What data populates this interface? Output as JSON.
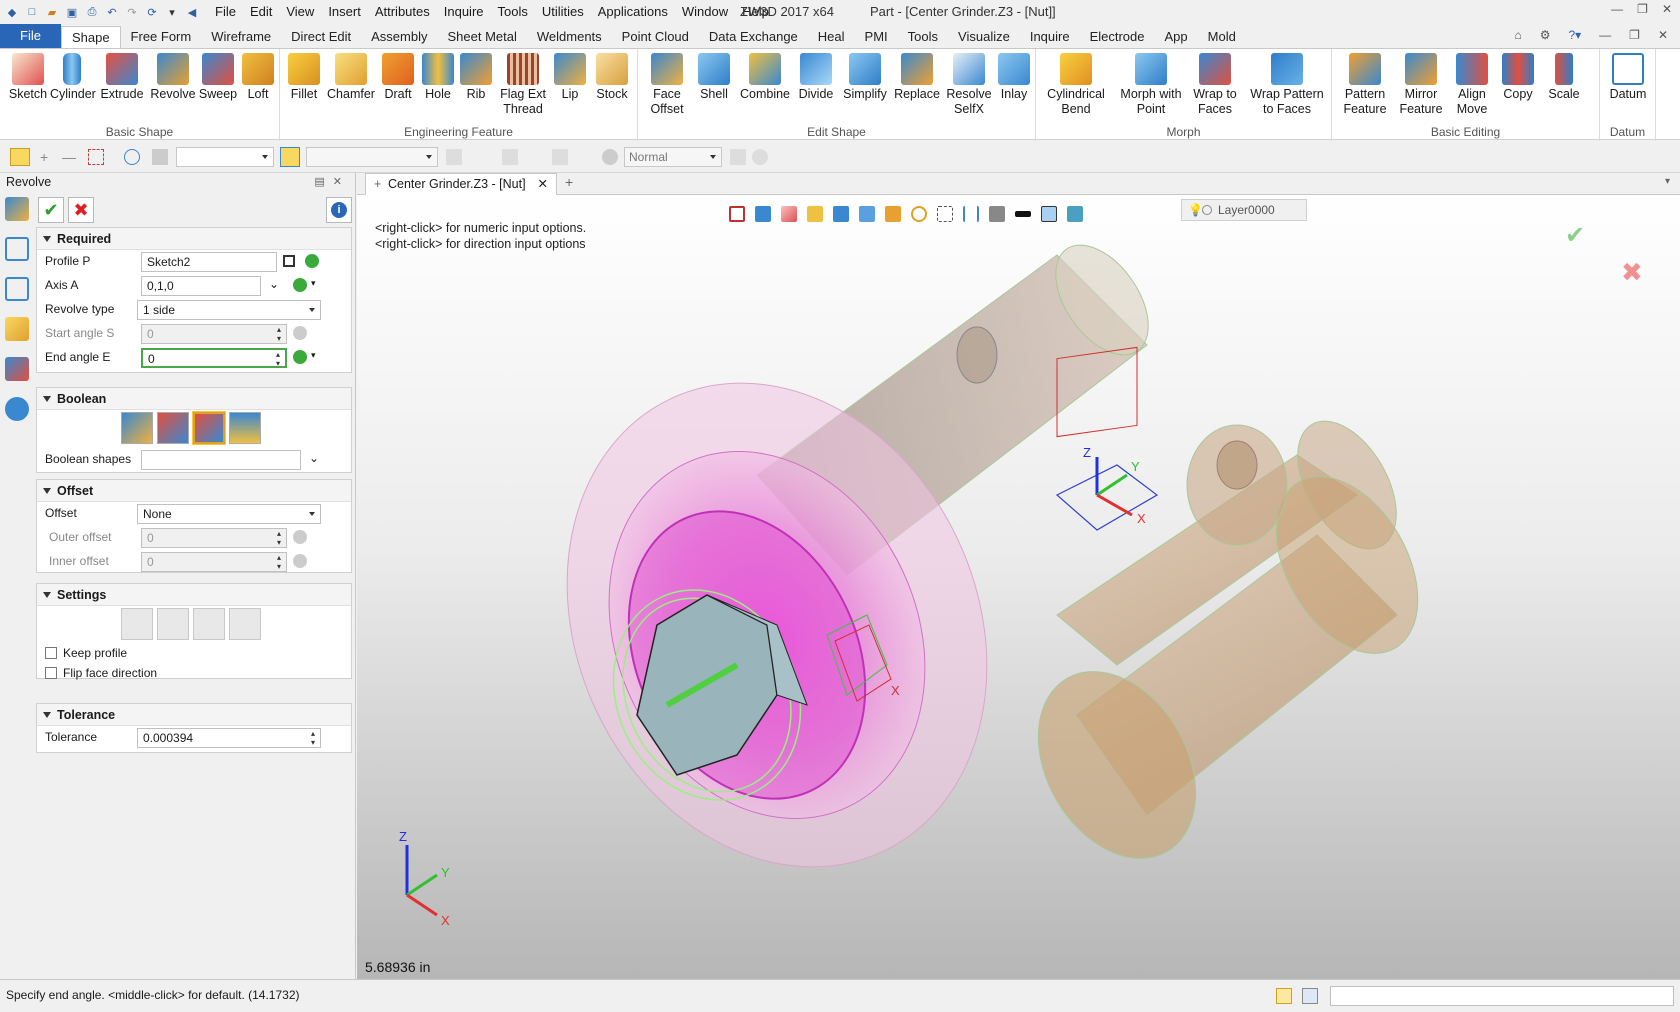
{
  "titlebar": {
    "menu": [
      "File",
      "Edit",
      "View",
      "Insert",
      "Attributes",
      "Inquire",
      "Tools",
      "Utilities",
      "Applications",
      "Window",
      "Help"
    ],
    "app_title": "ZW3D 2017  x64",
    "doc_title": "Part - [Center Grinder.Z3 - [Nut]]"
  },
  "ribbon_tabs": [
    "File",
    "Shape",
    "Free Form",
    "Wireframe",
    "Direct Edit",
    "Assembly",
    "Sheet Metal",
    "Weldments",
    "Point Cloud",
    "Data Exchange",
    "Heal",
    "PMI",
    "Tools",
    "Visualize",
    "Inquire",
    "Electrode",
    "App",
    "Mold"
  ],
  "ribbon_groups": [
    {
      "label": "Basic Shape",
      "buttons": [
        "Sketch",
        "Cylinder",
        "Extrude",
        "Revolve",
        "Sweep",
        "Loft"
      ]
    },
    {
      "label": "Engineering Feature",
      "buttons": [
        "Fillet",
        "Chamfer",
        "Draft",
        "Hole",
        "Rib",
        "Flag Ext Thread",
        "Lip",
        "Stock"
      ]
    },
    {
      "label": "Edit Shape",
      "buttons": [
        "Face Offset",
        "Shell",
        "Combine",
        "Divide",
        "Simplify",
        "Replace",
        "Resolve SelfX",
        "Inlay"
      ]
    },
    {
      "label": "Morph",
      "buttons": [
        "Cylindrical Bend",
        "Morph with Point",
        "Wrap to Faces",
        "Wrap Pattern to Faces"
      ]
    },
    {
      "label": "Basic Editing",
      "buttons": [
        "Pattern Feature",
        "Mirror Feature",
        "Align Move",
        "Copy",
        "Scale"
      ]
    },
    {
      "label": "Datum",
      "buttons": [
        "Datum"
      ]
    }
  ],
  "cmdbar": {
    "render_mode": "Normal"
  },
  "panel": {
    "title": "Revolve",
    "required": {
      "title": "Required",
      "profile_label": "Profile P",
      "profile_value": "Sketch2",
      "axis_label": "Axis A",
      "axis_value": "0,1,0",
      "revolve_type_label": "Revolve type",
      "revolve_type_value": "1 side",
      "start_label": "Start angle S",
      "start_value": "0",
      "end_label": "End angle E",
      "end_value": "0"
    },
    "boolean": {
      "title": "Boolean",
      "shapes_label": "Boolean shapes"
    },
    "offset": {
      "title": "Offset",
      "offset_label": "Offset",
      "offset_value": "None",
      "outer_label": "Outer offset",
      "outer_value": "0",
      "inner_label": "Inner offset",
      "inner_value": "0"
    },
    "settings": {
      "title": "Settings",
      "keep_profile": "Keep profile",
      "flip_face": "Flip face direction"
    },
    "tolerance": {
      "title": "Tolerance",
      "label": "Tolerance",
      "value": "0.000394"
    }
  },
  "doc_tab": "Center Grinder.Z3 - [Nut]",
  "viewport": {
    "layer": "Layer0000",
    "hint1": "<right-click> for numeric input options.",
    "hint2": "<right-click> for direction input options",
    "distance": "5.68936 in",
    "axis_labels": {
      "x": "X",
      "y": "Y",
      "z": "Z"
    }
  },
  "status": {
    "message": "Specify end angle.  <middle-click> for default. (14.1732)"
  }
}
